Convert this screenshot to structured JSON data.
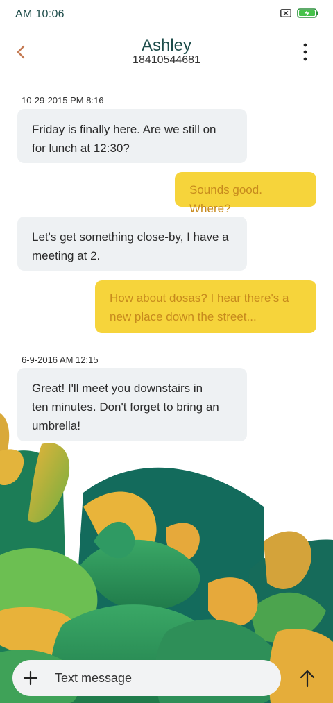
{
  "status_bar": {
    "time": "AM  10:06",
    "icons": [
      "sim-blocked-icon",
      "battery-charging-icon"
    ]
  },
  "header": {
    "contact_name": "Ashley",
    "contact_number": "18410544681",
    "icons": [
      "back-arrow-icon",
      "more-vertical-icon"
    ]
  },
  "conversation": {
    "timestamps": [
      "10-29-2015 PM 8:16",
      "6-9-2016 AM 12:15"
    ],
    "messages": [
      {
        "direction": "incoming",
        "lines": [
          "Friday is finally here. Are we still on",
          "for lunch at 12:30?"
        ]
      },
      {
        "direction": "outgoing",
        "lines": [
          "Sounds good. Where?"
        ]
      },
      {
        "direction": "incoming",
        "lines": [
          "Let's get something close-by, I have a",
          "meeting at 2."
        ]
      },
      {
        "direction": "outgoing",
        "lines": [
          "How about dosas? I hear there's a",
          "new place down the street..."
        ]
      },
      {
        "direction": "incoming",
        "lines": [
          "Great! I'll meet you downstairs in",
          "ten minutes. Don't forget to bring an",
          "umbrella!"
        ]
      }
    ]
  },
  "composer": {
    "placeholder": "Text message",
    "icons": [
      "plus-icon",
      "send-arrow-icon"
    ]
  },
  "colors": {
    "incoming_bubble": "#eef1f3",
    "outgoing_bubble": "#f6d43b",
    "outgoing_text": "#c78a1d",
    "accent_teal": "#1e4d4b"
  }
}
